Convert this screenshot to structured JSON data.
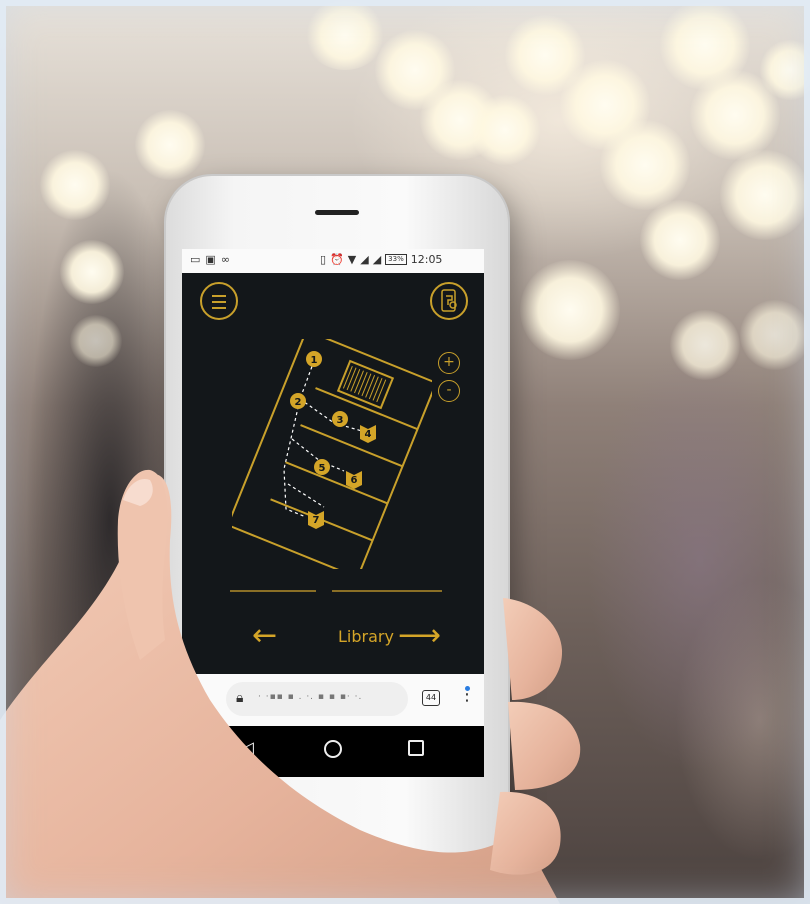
{
  "status_bar": {
    "left_icons": [
      "cast-icon",
      "image-icon",
      "infinity-icon"
    ],
    "right_icons": [
      "vibrate-icon",
      "alarm-icon",
      "wifi-icon",
      "signal-icon",
      "signal-icon"
    ],
    "battery": "33%",
    "time": "12:05"
  },
  "map": {
    "waypoints": [
      "1",
      "2",
      "3",
      "4",
      "5",
      "6",
      "7"
    ],
    "zoom_in_label": "+",
    "zoom_out_label": "-",
    "accent_color": "#d4a528"
  },
  "navigation": {
    "back_arrow": "←",
    "next_label": "Library",
    "next_arrow": "⟶"
  },
  "browser": {
    "address_text": "· ·▪▪ ▪ . ·. ▪ ▪ ▪· ·.",
    "tab_count": "44"
  },
  "android_nav": {
    "back": "◁",
    "home": "○",
    "recents": "□"
  }
}
